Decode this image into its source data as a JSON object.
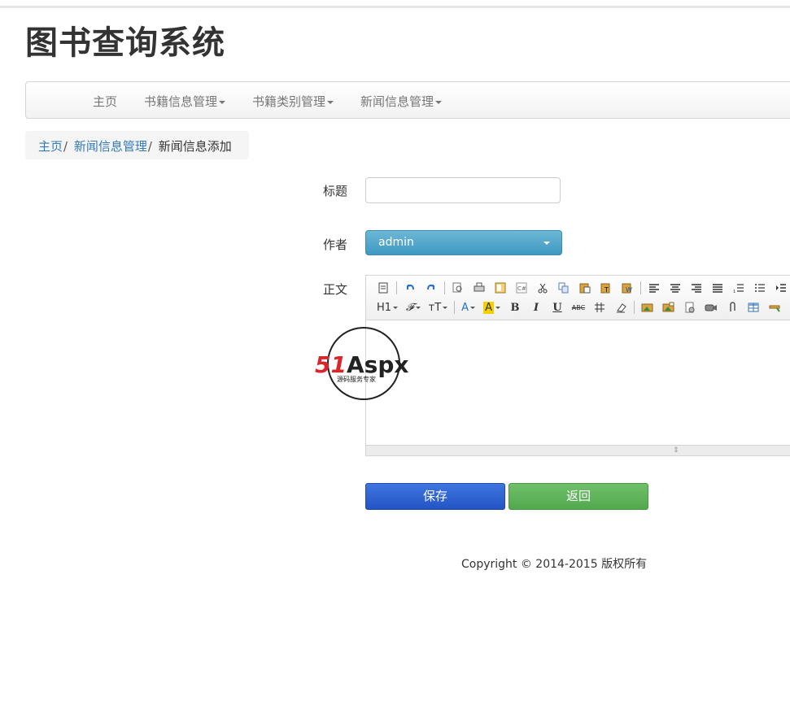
{
  "site": {
    "title": "图书查询系统"
  },
  "nav": {
    "items": [
      {
        "label": "主页",
        "dropdown": false
      },
      {
        "label": "书籍信息管理",
        "dropdown": true
      },
      {
        "label": "书籍类别管理",
        "dropdown": true
      },
      {
        "label": "新闻信息管理",
        "dropdown": true
      }
    ]
  },
  "breadcrumb": {
    "items": [
      "主页",
      "新闻信息管理",
      "新闻信息添加"
    ],
    "separator": "/"
  },
  "form": {
    "title_label": "标题",
    "title_value": "",
    "author_label": "作者",
    "author_selected": "admin",
    "body_label": "正文",
    "body_value": ""
  },
  "editor": {
    "toolbar_row1": [
      "source-icon",
      "undo-icon",
      "redo-icon",
      "preview-icon",
      "print-icon",
      "template-icon",
      "code-icon",
      "cut-icon",
      "copy-icon",
      "paste-icon",
      "paste-text-icon",
      "paste-word-icon",
      "align-left-icon",
      "align-center-icon",
      "align-right-icon",
      "justify-icon",
      "ordered-list-icon",
      "unordered-list-icon",
      "indent-icon"
    ],
    "heading_label": "H1",
    "font_label": "𝓕",
    "size_label": "тT",
    "font_color_label": "A",
    "highlight_label": "A",
    "bold_label": "B",
    "italic_label": "I",
    "underline_label": "U",
    "strike_label": "ABC"
  },
  "watermark": {
    "brand": "51Aspx",
    "tagline": "源码服务专家"
  },
  "buttons": {
    "save": "保存",
    "back": "返回"
  },
  "footer": {
    "copyright": "Copyright © 2014-2015 版权所有"
  },
  "colors": {
    "link": "#337ab7",
    "save": "#2f63d3",
    "back": "#5fb35a",
    "select": "#4da3cc"
  }
}
